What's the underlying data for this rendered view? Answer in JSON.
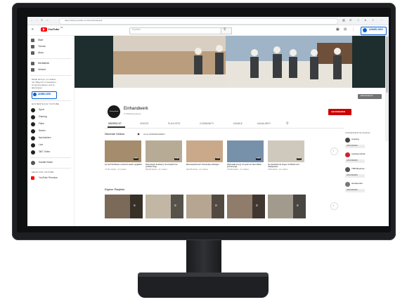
{
  "browser": {
    "url": "https://www.youtube.com/c/einhandwerk"
  },
  "youtube": {
    "logo_text": "YouTube",
    "country": "DE",
    "search_placeholder": "Suchen",
    "signin_label": "ANMELDEN"
  },
  "sidebar": {
    "items": [
      {
        "label": "Start",
        "icon": "home-icon"
      },
      {
        "label": "Trends",
        "icon": "trending-icon"
      },
      {
        "label": "Abos",
        "icon": "subscriptions-icon"
      },
      {
        "label": "Mediathek",
        "icon": "library-icon"
      },
      {
        "label": "Verlauf",
        "icon": "history-icon"
      }
    ],
    "signin_hint_lines": [
      "Melde dich an, um Videos",
      "mit \"Mag ich\" zu bewerten,",
      "zu kommentieren und zu",
      "abonnieren."
    ],
    "signin_button": "ANMELDEN",
    "best_of_title": "DAS BESTE AUF YOUTUBE",
    "best_of": [
      {
        "label": "Sport"
      },
      {
        "label": "Gaming"
      },
      {
        "label": "Filme"
      },
      {
        "label": "Serien"
      },
      {
        "label": "Nachrichten"
      },
      {
        "label": "Live"
      },
      {
        "label": "360°-Video"
      }
    ],
    "browse_channels": "Kanäle finden",
    "more_title": "MEHR VON YOUTUBE",
    "premium": "YouTube Premium"
  },
  "channel": {
    "name": "Einhandwerk",
    "subscribers": "2.730 Abonnenten",
    "subscribe_label": "ABONNIEREN",
    "tabs": [
      "ÜBERSICHT",
      "VIDEOS",
      "PLAYLISTS",
      "COMMUNITY",
      "KANÄLE",
      "KANALINFO"
    ],
    "banner_link": "Einhandwerk"
  },
  "sections": {
    "uploads": {
      "title": "Neueste Videos",
      "play_all": "ALLE WIEDERGEBEN",
      "videos": [
        {
          "title": "So wird Sichtbeton schnell & sauber geglättet!",
          "meta": "1.5 Mio. Aufrufe · vor 2 Jahren",
          "duration": "8:47",
          "color": "#a48c6c"
        },
        {
          "title": "Fliesenleger Anleitung: So entsteht eine perfekte Fuge",
          "meta": "265.000 Aufrufe · vor 2 Jahren",
          "duration": "5:48",
          "color": "#b7ab95"
        },
        {
          "title": "Betonspachtel auf Trockenbau auftragen",
          "meta": "100.000 Aufrufe · vor 2 Jahren",
          "duration": "7:21",
          "color": "#c9a98a"
        },
        {
          "title": "Wärmedämmung: So spart ein alter Altbau jetzt Energie",
          "meta": "170.000 Aufrufe · vor 3 Jahren",
          "duration": "4:53",
          "color": "#7891ab"
        },
        {
          "title": "So spachtelst du Fugen mit Mörtel und Glasgewebe",
          "meta": "1.900 Aufrufe · vor 2 Jahren",
          "duration": "6:15",
          "color": "#cfc9bd"
        }
      ]
    },
    "shorts": {
      "title": "Eigene Playlists",
      "thumbs": [
        "#7b6a58",
        "#c2b7a5",
        "#b5a591",
        "#8f7c6a",
        "#a39a8e"
      ]
    }
  },
  "right_panel": {
    "title": "AUSGEWÄHLTE KANÄLE",
    "channels": [
      {
        "name": "Ausstrig",
        "button": "ABONNIEREN",
        "color": "#444444"
      },
      {
        "name": "Ausstrig Kanal",
        "button": "ABONNIEREN",
        "color": "#cc2233"
      },
      {
        "name": "TBM Baulinse",
        "button": "ABONNIEREN",
        "color": "#555555"
      },
      {
        "name": "Handwerker",
        "button": "ABONNIEREN",
        "color": "#777777"
      }
    ]
  },
  "colors": {
    "youtube_red": "#ff0000",
    "subscribe_red": "#cc0000",
    "signin_blue": "#065fd4",
    "bezel": "#1d1f22"
  }
}
